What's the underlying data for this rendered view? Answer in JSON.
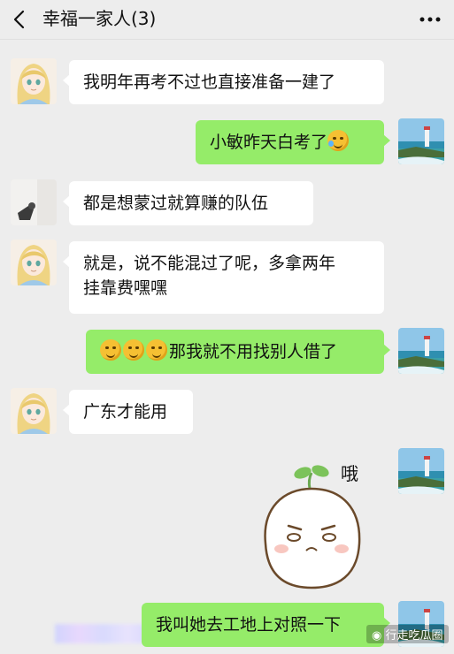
{
  "header": {
    "title": "幸福一家人(3)",
    "back_icon": "chevron-left-icon",
    "more_icon": "more-dots-icon"
  },
  "colors": {
    "background": "#ededed",
    "bubble_in": "#ffffff",
    "bubble_out": "#95ec69"
  },
  "messages": [
    {
      "side": "left",
      "sender": "anime-girl",
      "text": "我明年再考不过也直接准备一建了"
    },
    {
      "side": "right",
      "sender": "self",
      "text": "小敏昨天白考了",
      "trailing_emoji": "tears-of-joy-emoji"
    },
    {
      "side": "left",
      "sender": "member-2",
      "text": "都是想蒙过就算赚的队伍"
    },
    {
      "side": "left",
      "sender": "anime-girl",
      "text_line1": "就是，说不能混过了呢，多拿两年",
      "text_line2": "挂靠费嘿嘿"
    },
    {
      "side": "right",
      "sender": "self",
      "leading_emoji": "face-with-hand-over-mouth-emoji x3",
      "text": "那我就不用找别人借了"
    },
    {
      "side": "left",
      "sender": "anime-girl",
      "text": "广东才能用"
    },
    {
      "side": "right",
      "sender": "self",
      "sticker": "sprout-bun-sticker",
      "sticker_text": "哦"
    },
    {
      "side": "right",
      "sender": "self",
      "text": "我叫她去工地上对照一下"
    }
  ],
  "watermark": {
    "text": "行走吃瓜圈",
    "icon": "wechat-logo-icon"
  }
}
